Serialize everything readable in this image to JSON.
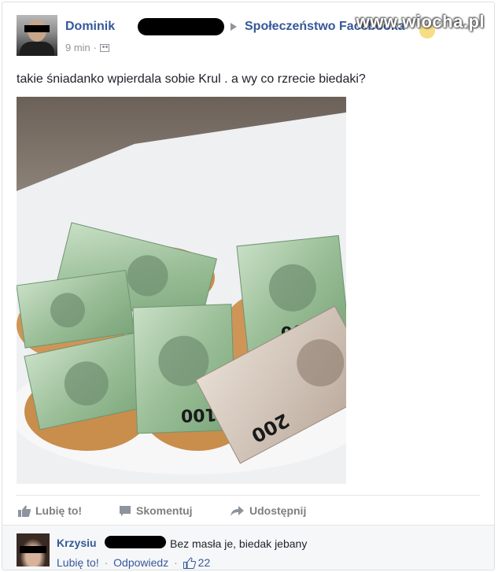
{
  "post": {
    "author": "Dominik",
    "group": "Społeczeństwo Facebooka",
    "time": "9 min",
    "separator": "·",
    "audience_icon": "people-icon",
    "text": "takie śniadanko wpierdala sobie Krul . a wy co rzrecie biedaki?",
    "photo_description": "plate of buttered bread slices topped with 100 and 200 złoty banknotes"
  },
  "watermark": "www.wiocha.pl",
  "actions": {
    "like": "Lubię to!",
    "comment": "Skomentuj",
    "share": "Udostępnij"
  },
  "comment": {
    "author": "Krzysiu",
    "text": "Bez masła je, biedak jebany",
    "like": "Lubię to!",
    "reply": "Odpowiedz",
    "dot": "·",
    "likes_count": "22"
  },
  "colors": {
    "link": "#365899",
    "muted": "#90949c",
    "text": "#1d2129",
    "action": "#7f7f7f"
  }
}
